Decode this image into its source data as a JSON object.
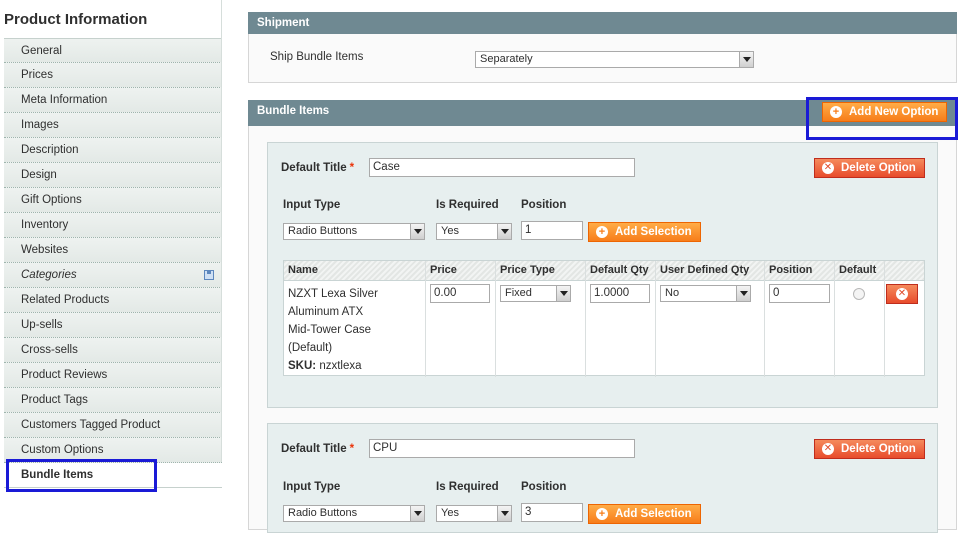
{
  "sidebar": {
    "title": "Product Information",
    "items": [
      {
        "label": "General"
      },
      {
        "label": "Prices"
      },
      {
        "label": "Meta Information"
      },
      {
        "label": "Images"
      },
      {
        "label": "Description"
      },
      {
        "label": "Design"
      },
      {
        "label": "Gift Options"
      },
      {
        "label": "Inventory"
      },
      {
        "label": "Websites"
      },
      {
        "label": "Categories"
      },
      {
        "label": "Related Products"
      },
      {
        "label": "Up-sells"
      },
      {
        "label": "Cross-sells"
      },
      {
        "label": "Product Reviews"
      },
      {
        "label": "Product Tags"
      },
      {
        "label": "Customers Tagged Product"
      },
      {
        "label": "Custom Options"
      },
      {
        "label": "Bundle Items"
      }
    ]
  },
  "shipment": {
    "title": "Shipment",
    "label": "Ship Bundle Items",
    "value": "Separately"
  },
  "bundle": {
    "title": "Bundle Items",
    "add_option": "Add New Option",
    "delete_option": "Delete Option",
    "add_selection": "Add Selection",
    "default_title_label": "Default Title",
    "required_mark": "*",
    "input_type_label": "Input Type",
    "is_required_label": "Is Required",
    "position_label": "Position",
    "columns": {
      "name": "Name",
      "price": "Price",
      "price_type": "Price Type",
      "default_qty": "Default Qty",
      "user_defined_qty": "User Defined Qty",
      "position": "Position",
      "default": "Default"
    },
    "options": [
      {
        "title": "Case",
        "input_type": "Radio Buttons",
        "is_required": "Yes",
        "position": "1",
        "selection": {
          "name_lines": [
            "NZXT Lexa Silver",
            "Aluminum ATX",
            "Mid-Tower Case",
            "(Default)"
          ],
          "sku_label": "SKU:",
          "sku": "nzxtlexa",
          "price": "0.00",
          "price_type": "Fixed",
          "default_qty": "1.0000",
          "user_defined_qty": "No",
          "position": "0"
        }
      },
      {
        "title": "CPU",
        "input_type": "Radio Buttons",
        "is_required": "Yes",
        "position": "3"
      }
    ]
  }
}
